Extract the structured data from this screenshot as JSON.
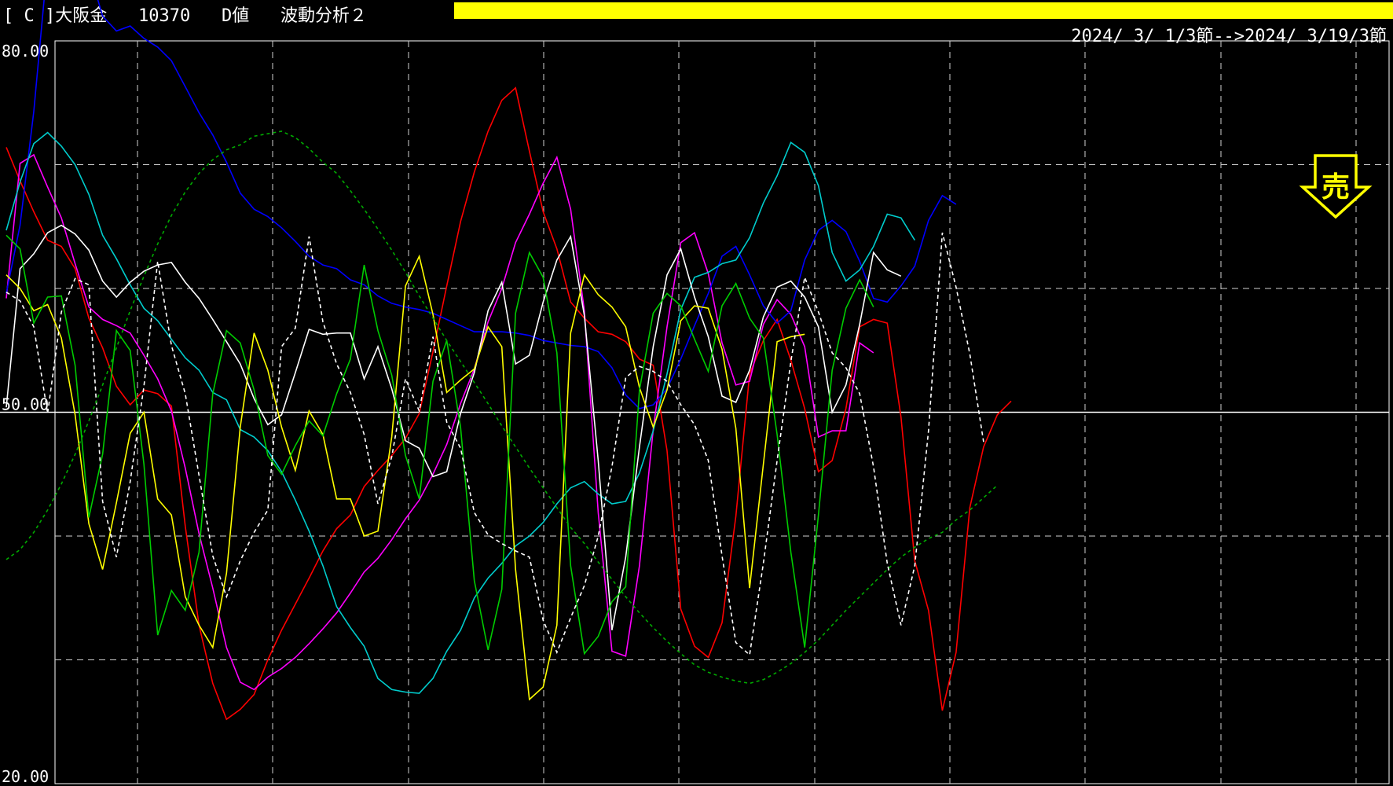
{
  "header": {
    "bracket_label": "[ C ]",
    "instrument": "大阪金",
    "code": "10370",
    "indicator": "D値",
    "mode": "波動分析２",
    "date_range": "2024/ 3/ 1/3節-->2024/ 3/19/3節",
    "bar_color": "#ffff00"
  },
  "signal": {
    "label": "売",
    "icon": "down-arrow-icon",
    "color": "#ffff00"
  },
  "chart_data": {
    "type": "line",
    "title": "",
    "xlabel": "",
    "ylabel": "",
    "ylim": [
      20,
      80
    ],
    "yticks": [
      20,
      50,
      80
    ],
    "ytick_labels": [
      "20.00",
      "50.00",
      "80.00"
    ],
    "reference_line": 50,
    "grid": true,
    "x": [
      0,
      1,
      2,
      3,
      4,
      5,
      6,
      7,
      8,
      9,
      10,
      11,
      12,
      13,
      14,
      15,
      16,
      17,
      18,
      19,
      20,
      21,
      22,
      23,
      24,
      25,
      26,
      27,
      28,
      29,
      30,
      31,
      32,
      33,
      34,
      35,
      36,
      37,
      38,
      39,
      40,
      41,
      42,
      43,
      44,
      45,
      46,
      47,
      48,
      49,
      50,
      51,
      52,
      53,
      54,
      55,
      56,
      57,
      58,
      59,
      60,
      61,
      62,
      63,
      64,
      65,
      66,
      67,
      68,
      69,
      70,
      71,
      72,
      73,
      74,
      75,
      76,
      77,
      78,
      79,
      80,
      81,
      82,
      83,
      84,
      85,
      86,
      87,
      88,
      89,
      90,
      91,
      92,
      93,
      94,
      95,
      96,
      97,
      98,
      99,
      100
    ],
    "series": [
      {
        "color": "#ff0000",
        "style": "solid",
        "values": [
          71.4,
          68.7,
          66.2,
          63.9,
          63.4,
          61.6,
          57.6,
          55.2,
          52.1,
          50.6,
          51.8,
          51.5,
          50.5,
          40.8,
          32.8,
          28.1,
          25.2,
          26.0,
          27.2,
          30.0,
          32.4,
          34.5,
          36.6,
          38.8,
          40.6,
          41.7,
          44.0,
          45.3,
          46.5,
          47.9,
          49.9,
          54.9,
          60.2,
          65.4,
          69.4,
          72.7,
          75.2,
          76.2,
          71.1,
          66.2,
          63.2,
          58.9,
          57.6,
          56.5,
          56.3,
          55.7,
          54.3,
          53.8,
          46.9,
          34.1,
          31.1,
          30.2,
          33.0,
          41.6,
          53.1,
          55.8,
          57.5,
          54.2,
          50.3,
          45.2,
          46.1,
          50.3,
          56.9,
          57.5,
          57.2,
          49.6,
          38.0,
          34.0,
          25.9,
          30.6,
          42.3,
          47.2,
          49.8,
          50.9
        ]
      },
      {
        "color": "#ff00ff",
        "style": "solid",
        "values": [
          59.2,
          70.1,
          70.8,
          68.2,
          65.7,
          62.0,
          58.5,
          57.5,
          57.0,
          56.4,
          54.6,
          52.7,
          50.1,
          45.5,
          40.2,
          35.8,
          31.0,
          28.2,
          27.6,
          28.6,
          29.3,
          30.2,
          31.3,
          32.5,
          33.8,
          35.4,
          37.1,
          38.2,
          39.7,
          41.4,
          42.9,
          45.0,
          47.4,
          50.7,
          53.5,
          57.3,
          60.0,
          63.7,
          66.0,
          68.5,
          70.6,
          66.4,
          58.2,
          41.9,
          30.7,
          30.3,
          37.6,
          48.6,
          56.9,
          63.7,
          64.5,
          61.2,
          55.6,
          52.2,
          52.5,
          57.1,
          59.1,
          57.9,
          55.3,
          48.0,
          48.5,
          48.5,
          55.6,
          54.8
        ]
      },
      {
        "color": "#0000ff",
        "style": "solid",
        "values": [
          59.6,
          65.1,
          74.3,
          86.4,
          89.3,
          88.8,
          85.8,
          82.0,
          80.8,
          81.2,
          80.2,
          79.5,
          78.4,
          76.3,
          74.2,
          72.4,
          70.2,
          67.7,
          66.4,
          65.8,
          64.9,
          63.8,
          62.6,
          61.9,
          61.6,
          60.7,
          60.3,
          59.4,
          58.8,
          58.5,
          58.3,
          58.0,
          57.5,
          57.0,
          56.5,
          56.5,
          56.5,
          56.4,
          56.2,
          55.8,
          55.6,
          55.4,
          55.3,
          54.9,
          53.6,
          51.4,
          50.3,
          50.6,
          51.9,
          54.3,
          57.0,
          59.6,
          62.6,
          63.4,
          61.1,
          58.6,
          57.2,
          58.2,
          62.3,
          64.7,
          65.5,
          64.6,
          62.2,
          59.2,
          58.9,
          60.2,
          61.8,
          65.5,
          67.5,
          66.8
        ]
      },
      {
        "color": "#00cccc",
        "style": "solid",
        "values": [
          64.7,
          68.6,
          71.7,
          72.6,
          71.5,
          70.0,
          67.6,
          64.3,
          62.4,
          60.3,
          58.4,
          57.4,
          55.9,
          54.4,
          53.4,
          51.6,
          51.0,
          48.6,
          48.0,
          46.9,
          45.2,
          42.9,
          40.4,
          37.6,
          34.3,
          32.6,
          31.1,
          28.5,
          27.6,
          27.4,
          27.3,
          28.5,
          30.7,
          32.4,
          35.0,
          36.6,
          37.8,
          39.2,
          40.0,
          41.1,
          42.6,
          43.9,
          44.4,
          43.4,
          42.6,
          42.8,
          45.1,
          48.5,
          53.1,
          58.3,
          60.9,
          61.3,
          62.0,
          62.3,
          64.1,
          66.9,
          69.1,
          71.8,
          71.0,
          68.3,
          62.9,
          60.6,
          61.5,
          63.4,
          66.0,
          65.7,
          63.9
        ]
      },
      {
        "color": "#ffffff",
        "style": "solid",
        "values": [
          50.4,
          61.6,
          62.8,
          64.5,
          65.1,
          64.4,
          63.1,
          60.6,
          59.3,
          60.5,
          61.4,
          61.9,
          62.1,
          60.5,
          59.2,
          57.5,
          55.7,
          53.9,
          51.1,
          49.0,
          49.8,
          53.2,
          56.7,
          56.3,
          56.4,
          56.4,
          52.7,
          55.3,
          51.9,
          47.7,
          47.1,
          44.8,
          45.2,
          49.9,
          53.2,
          58.2,
          60.5,
          53.9,
          54.6,
          58.9,
          62.3,
          64.2,
          57.8,
          46.1,
          32.4,
          38.3,
          47.2,
          55.3,
          61.1,
          63.2,
          59.3,
          56.1,
          51.3,
          50.8,
          53.4,
          57.7,
          60.1,
          60.6,
          59.3,
          56.9,
          50.0,
          52.2,
          57.1,
          62.9,
          61.5,
          61.0
        ]
      },
      {
        "color": "#ffff00",
        "style": "solid",
        "values": [
          61.1,
          60.0,
          58.2,
          58.7,
          56.0,
          49.8,
          41.0,
          37.3,
          42.7,
          48.3,
          50.0,
          43.0,
          41.7,
          35.1,
          32.8,
          31.0,
          37.0,
          48.8,
          56.4,
          53.4,
          48.8,
          45.3,
          50.1,
          48.2,
          43.0,
          43.0,
          40.0,
          40.4,
          48.0,
          60.2,
          62.6,
          57.9,
          51.6,
          52.6,
          53.5,
          56.9,
          55.3,
          37.3,
          26.8,
          27.8,
          32.8,
          56.4,
          61.1,
          59.5,
          58.5,
          56.9,
          52.0,
          48.8,
          51.8,
          57.4,
          58.6,
          58.4,
          55.1,
          48.7,
          35.8,
          45.8,
          55.7,
          56.1,
          56.3
        ]
      },
      {
        "color": "#00cc00",
        "style": "solid",
        "values": [
          64.3,
          63.2,
          57.2,
          59.3,
          59.4,
          53.8,
          41.5,
          46.6,
          56.6,
          55.0,
          45.8,
          32.0,
          35.6,
          34.0,
          38.7,
          51.5,
          56.6,
          55.6,
          51.8,
          46.5,
          45.0,
          47.3,
          49.3,
          48.1,
          51.5,
          54.3,
          61.9,
          56.6,
          53.0,
          46.5,
          43.0,
          52.5,
          55.8,
          48.8,
          36.4,
          30.8,
          35.7,
          58.0,
          62.9,
          60.9,
          54.8,
          37.6,
          30.5,
          31.9,
          34.7,
          35.9,
          51.8,
          58.0,
          59.6,
          58.6,
          55.9,
          53.3,
          58.6,
          60.4,
          57.6,
          56.0,
          48.2,
          38.7,
          31.0,
          41.7,
          53.4,
          58.4,
          60.7,
          58.5
        ]
      },
      {
        "color": "#ffffff",
        "style": "dashed",
        "values": [
          59.7,
          59.0,
          56.9,
          49.9,
          58.1,
          60.8,
          60.3,
          42.8,
          38.3,
          44.4,
          52.1,
          62.2,
          55.4,
          51.5,
          44.9,
          38.4,
          35.1,
          38.0,
          40.3,
          42.1,
          55.3,
          56.8,
          64.2,
          57.3,
          53.9,
          51.6,
          48.2,
          42.6,
          46.4,
          52.7,
          50.1,
          56.1,
          49.2,
          47.1,
          41.9,
          40.1,
          39.4,
          38.8,
          38.3,
          33.2,
          30.6,
          33.4,
          36.0,
          40.0,
          45.6,
          52.8,
          53.7,
          53.3,
          52.5,
          50.6,
          49.0,
          46.1,
          38.4,
          31.4,
          30.4,
          37.8,
          46.1,
          54.1,
          60.9,
          58.1,
          54.8,
          53.6,
          51.5,
          45.6,
          37.8,
          32.8,
          37.6,
          48.5,
          64.5,
          60.1,
          54.7,
          47.6
        ]
      },
      {
        "color": "#00aa00",
        "style": "dotted",
        "values": [
          38.1,
          38.9,
          40.3,
          42.1,
          44.2,
          46.6,
          49.3,
          52.2,
          55.2,
          58.2,
          61.0,
          63.6,
          65.9,
          67.8,
          69.3,
          70.4,
          71.2,
          71.6,
          72.3,
          72.5,
          72.7,
          72.2,
          71.3,
          70.2,
          69.3,
          67.9,
          66.4,
          64.8,
          63.1,
          61.3,
          59.4,
          57.6,
          55.8,
          54.1,
          52.4,
          50.7,
          48.9,
          47.2,
          45.5,
          43.9,
          42.3,
          40.7,
          39.4,
          37.9,
          36.5,
          35.1,
          33.8,
          32.6,
          31.5,
          30.5,
          29.6,
          29.0,
          28.6,
          28.3,
          28.1,
          28.4,
          29.0,
          29.7,
          30.6,
          31.6,
          32.8,
          34.0,
          35.1,
          36.2,
          37.3,
          38.3,
          39.1,
          39.8,
          40.3,
          41.3,
          42.1,
          43.1,
          44.1
        ]
      }
    ]
  }
}
